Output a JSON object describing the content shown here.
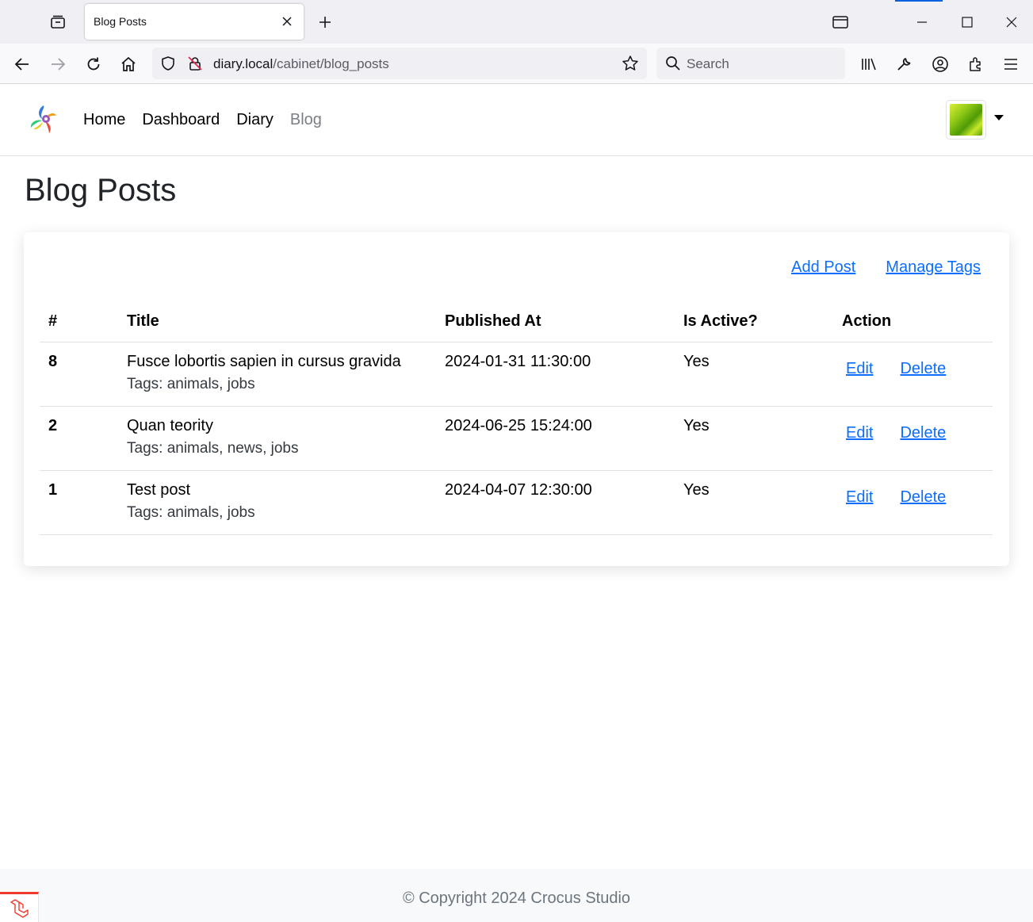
{
  "browser": {
    "tab_title": "Blog Posts",
    "url_host": "diary.local",
    "url_path": "/cabinet/blog_posts",
    "search_placeholder": "Search"
  },
  "site": {
    "nav": [
      "Home",
      "Dashboard",
      "Diary",
      "Blog"
    ],
    "active_nav": "Blog"
  },
  "page": {
    "title": "Blog Posts",
    "add_post": "Add Post",
    "manage_tags": "Manage Tags"
  },
  "table": {
    "headers": [
      "#",
      "Title",
      "Published At",
      "Is Active?",
      "Action"
    ],
    "rows": [
      {
        "id": "8",
        "title": "Fusce lobortis sapien in cursus gravida",
        "tags": "Tags: animals, jobs",
        "published_at": "2024-01-31 11:30:00",
        "is_active": "Yes",
        "edit": "Edit",
        "delete": "Delete"
      },
      {
        "id": "2",
        "title": "Quan teority",
        "tags": "Tags: animals, news, jobs",
        "published_at": "2024-06-25 15:24:00",
        "is_active": "Yes",
        "edit": "Edit",
        "delete": "Delete"
      },
      {
        "id": "1",
        "title": "Test post",
        "tags": "Tags: animals, jobs",
        "published_at": "2024-04-07 12:30:00",
        "is_active": "Yes",
        "edit": "Edit",
        "delete": "Delete"
      }
    ]
  },
  "footer": {
    "text": "© Copyright 2024 Crocus Studio"
  },
  "colors": {
    "link": "#0d6efd",
    "browser_accent": "#0061e0",
    "laravel_red": "#ef3b2d"
  }
}
